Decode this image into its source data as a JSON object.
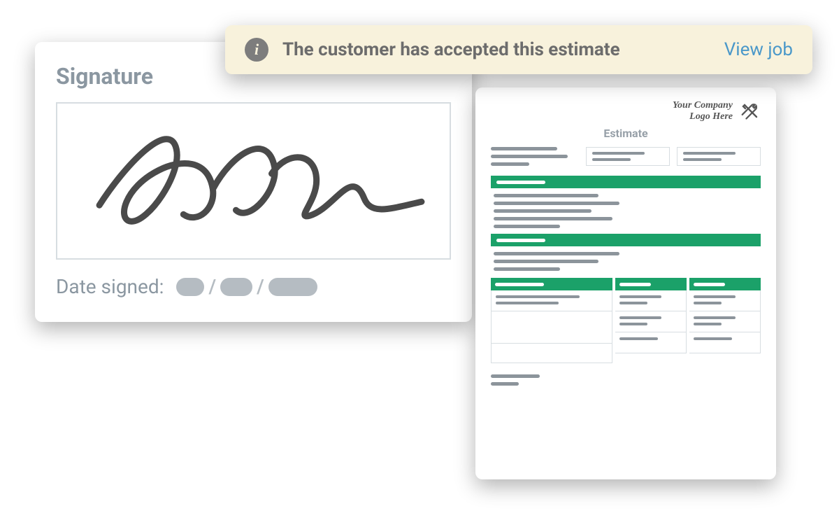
{
  "signature": {
    "title": "Signature",
    "date_label": "Date signed:"
  },
  "banner": {
    "message": "The customer has accepted this estimate",
    "link_label": "View job"
  },
  "document": {
    "logo_line1": "Your Company",
    "logo_line2": "Logo Here",
    "title": "Estimate",
    "accent_color": "#1ba169"
  }
}
